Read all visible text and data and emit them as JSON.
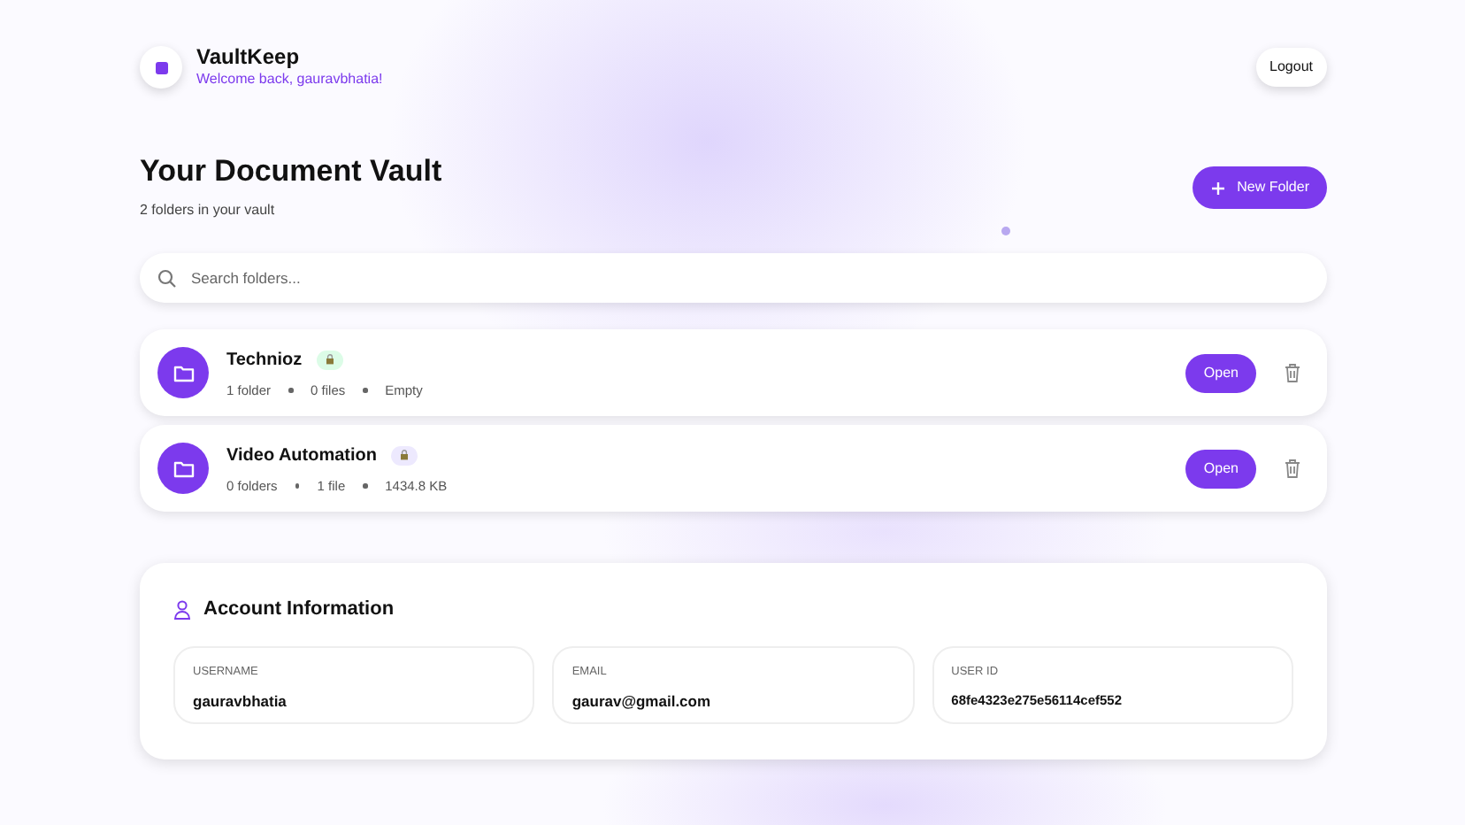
{
  "app": {
    "name": "VaultKeep",
    "welcome": "Welcome back, gauravbhatia!"
  },
  "logout": "Logout",
  "page": {
    "title": "Your Document Vault",
    "subtitle": "2 folders in your vault",
    "new_folder": "New Folder"
  },
  "search": {
    "placeholder": "Search folders..."
  },
  "folders": [
    {
      "name": "Technioz",
      "color": "#dcfce7",
      "stats": [
        "1 folder",
        "0 files",
        "Empty"
      ],
      "open": "Open"
    },
    {
      "name": "Video Automation",
      "color": "#ede9fe",
      "stats": [
        "0 folders",
        "1 file",
        "1434.8 KB"
      ],
      "open": "Open"
    }
  ],
  "account": {
    "title": "Account Information",
    "fields": [
      {
        "label": "USERNAME",
        "value": "gauravbhatia",
        "kind": "text"
      },
      {
        "label": "EMAIL",
        "value": "gaurav@gmail.com",
        "kind": "text"
      },
      {
        "label": "USER ID",
        "value": "68fe4323e275e56114cef552",
        "kind": "id"
      }
    ]
  }
}
